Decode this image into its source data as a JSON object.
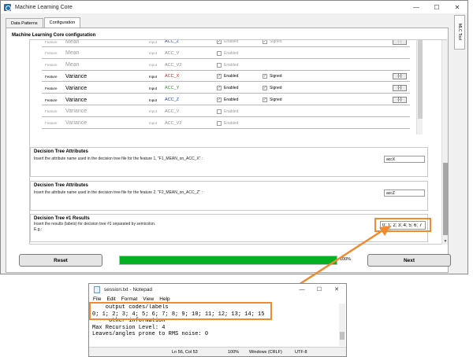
{
  "window": {
    "title": "Machine Learning Core",
    "controls": {
      "minimize": "—",
      "maximize": "☐",
      "close": "✕"
    }
  },
  "tabs": [
    {
      "label": "Data Patterns",
      "active": false
    },
    {
      "label": "Configuration",
      "active": true
    }
  ],
  "side_tab": {
    "label": "MLC Tool"
  },
  "section_title": "Machine Learning Core configuration",
  "features": [
    {
      "label": "Feature",
      "name": "Mean",
      "input_label": "Input",
      "input": "ACC_Z",
      "input_color": "#1c46d8",
      "enabled_label": "Enabled",
      "enabled": true,
      "signed_label": "Signed",
      "signed": true,
      "button": "(-)",
      "disabled": true
    },
    {
      "label": "Feature",
      "name": "Mean",
      "input_label": "Input",
      "input": "ACC_V",
      "input_color": "#8a8a8a",
      "enabled_label": "Enabled",
      "enabled": false,
      "signed_label": "",
      "signed": false,
      "button": "",
      "disabled": true
    },
    {
      "label": "Feature",
      "name": "Mean",
      "input_label": "Input",
      "input": "ACC_V2",
      "input_color": "#8a8a8a",
      "enabled_label": "Enabled",
      "enabled": false,
      "signed_label": "",
      "signed": false,
      "button": "",
      "disabled": true
    },
    {
      "label": "Feature",
      "name": "Variance",
      "input_label": "Input",
      "input": "ACC_X",
      "input_color": "#d42020",
      "enabled_label": "Enabled",
      "enabled": true,
      "signed_label": "Signed",
      "signed": true,
      "button": "(-)",
      "disabled": false
    },
    {
      "label": "Feature",
      "name": "Variance",
      "input_label": "Input",
      "input": "ACC_Y",
      "input_color": "#1f9a1f",
      "enabled_label": "Enabled",
      "enabled": true,
      "signed_label": "Signed",
      "signed": true,
      "button": "(-)",
      "disabled": false
    },
    {
      "label": "Feature",
      "name": "Variance",
      "input_label": "Input",
      "input": "ACC_Z",
      "input_color": "#1c46d8",
      "enabled_label": "Enabled",
      "enabled": true,
      "signed_label": "Signed",
      "signed": true,
      "button": "(-)",
      "disabled": false
    },
    {
      "label": "Feature",
      "name": "Variance",
      "input_label": "Input",
      "input": "ACC_V",
      "input_color": "#8a8a8a",
      "enabled_label": "Enabled",
      "enabled": false,
      "signed_label": "",
      "signed": false,
      "button": "",
      "disabled": true
    },
    {
      "label": "Feature",
      "name": "Variance",
      "input_label": "Input",
      "input": "ACC_V2",
      "input_color": "#8a8a8a",
      "enabled_label": "Enabled",
      "enabled": false,
      "signed_label": "",
      "signed": false,
      "button": "",
      "disabled": true
    }
  ],
  "attr1": {
    "title": "Decision Tree Attributes",
    "text": "Insert the attribute name used in the decision tree file for the feature 1, \"F1_MEAN_on_ACC_X\" :",
    "value": "accX"
  },
  "attr2": {
    "title": "Decision Tree Attributes",
    "text": "Insert the attribute name used in the decision tree file for the feature 2, \"F2_MEAN_on_ACC_Z\" :",
    "value": "accZ"
  },
  "results": {
    "title": "Decision Tree #1 Results",
    "text": "Insert the results (labels) for decision tree #1 separated by semicolon.",
    "example": "E.g.:",
    "value": "0; 1; 2; 3; 4; 5; 6; 7"
  },
  "bottom": {
    "reset_label": "Reset",
    "next_label": "Next",
    "progress": 100,
    "progress_text": "100%"
  },
  "notepad": {
    "title": "session.txt - Notepad",
    "menu": [
      "File",
      "Edit",
      "Format",
      "View",
      "Help"
    ],
    "lines": [
      "    output codes/labels",
      "0; 1; 2; 3; 4; 5; 6; 7; 8; 9; 10; 11; 12; 13; 14; 15",
      "",
      "---- other information",
      "Max Recursion Level: 4",
      "Leaves/angles prone to RMS noise: 0"
    ],
    "status": {
      "position": "Ln 56, Col 53",
      "zoom": "100%",
      "line_ending": "Windows (CRLF)",
      "encoding": "UTF-8"
    }
  },
  "colors": {
    "highlight": "#f28a30",
    "progress_fill": "#06b025"
  }
}
